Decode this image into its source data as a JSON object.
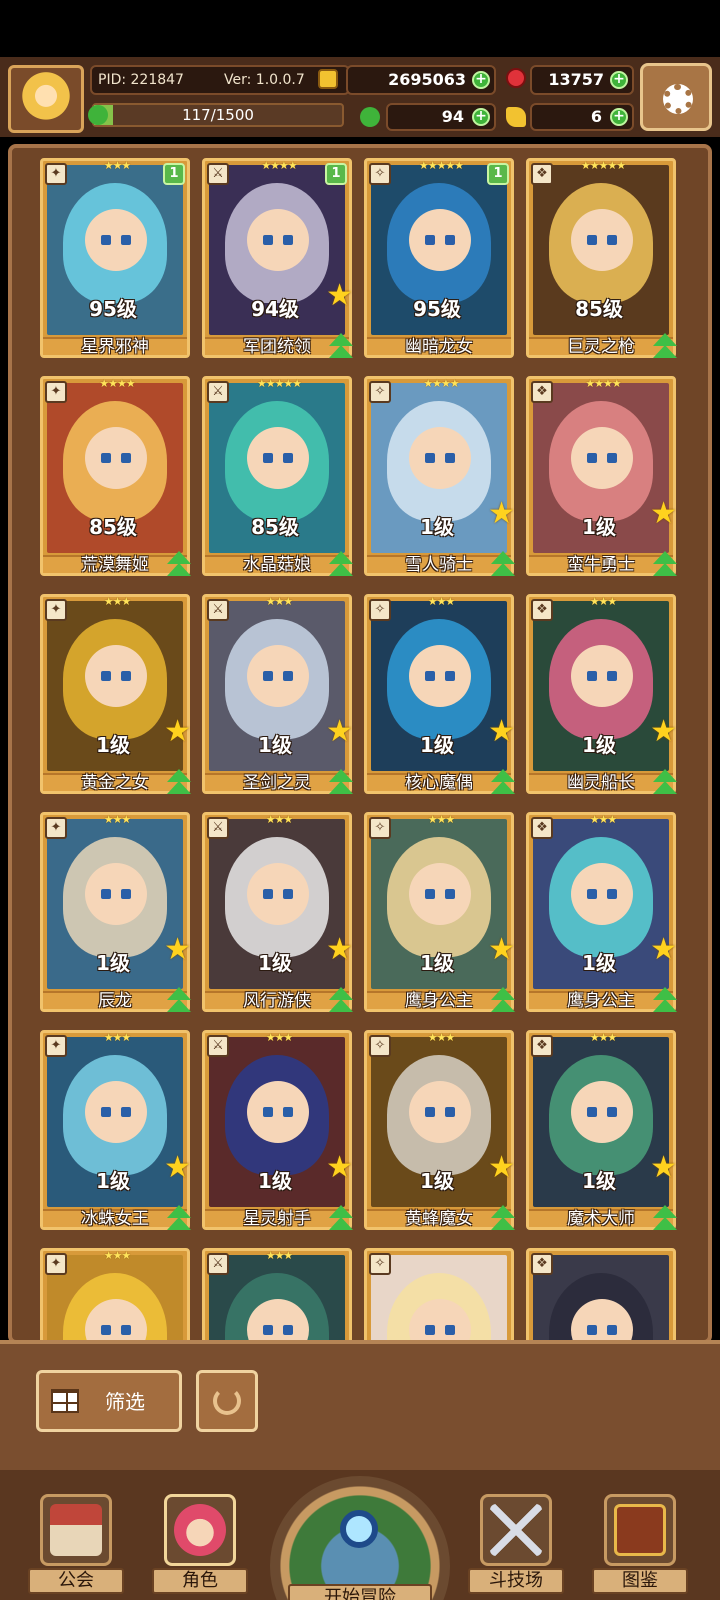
{
  "header": {
    "pid_label": "PID: 221847",
    "version_label": "Ver: 1.0.0.7",
    "gold": "2695063",
    "gems": "13757",
    "exp_text": "117/1500",
    "exp_fraction": 0.078,
    "clover": "94",
    "keys": "6",
    "icons": {
      "gold": "gold-coin-icon",
      "gems": "red-gem-icon",
      "clover": "clover-icon",
      "keys": "key-icon",
      "exp": "clover-exp-icon",
      "settings": "gear-icon"
    }
  },
  "heroes": [
    {
      "name": "星界邪神",
      "level": "95级",
      "stars": "★★★",
      "badge": "1",
      "hair": "#6fd2e8",
      "bg": "#3a6e8a",
      "star_icon": false,
      "upgrade": false
    },
    {
      "name": "军团统领",
      "level": "94级",
      "stars": "★★★★",
      "badge": "1",
      "hair": "#c7c0d8",
      "bg": "#3a2f55",
      "star_icon": true,
      "upgrade": true
    },
    {
      "name": "幽暗龙女",
      "level": "95级",
      "stars": "★★★★★",
      "badge": "1",
      "hair": "#2f84c7",
      "bg": "#1e4b6a",
      "star_icon": false,
      "upgrade": false
    },
    {
      "name": "巨灵之枪",
      "level": "85级",
      "stars": "★★★★★",
      "badge": "",
      "hair": "#f1c45a",
      "bg": "#5a3a1e",
      "star_icon": false,
      "upgrade": true
    },
    {
      "name": "荒漠舞姬",
      "level": "85级",
      "stars": "★★★★",
      "badge": "",
      "hair": "#f4c05a",
      "bg": "#b04a2a",
      "star_icon": false,
      "upgrade": true
    },
    {
      "name": "水晶菇娘",
      "level": "85级",
      "stars": "★★★★★",
      "badge": "",
      "hair": "#46c9b2",
      "bg": "#2a7a8a",
      "star_icon": false,
      "upgrade": true
    },
    {
      "name": "雪人骑士",
      "level": "1级",
      "stars": "★★★★",
      "badge": "",
      "hair": "#d6e6f2",
      "bg": "#6a9ac0",
      "star_icon": true,
      "upgrade": true
    },
    {
      "name": "蛮牛勇士",
      "level": "1级",
      "stars": "★★★★",
      "badge": "",
      "hair": "#e58a8a",
      "bg": "#8a4a4a",
      "star_icon": true,
      "upgrade": true
    },
    {
      "name": "黄金之女",
      "level": "1级",
      "stars": "★★★",
      "badge": "",
      "hair": "#e6b430",
      "bg": "#6a4a1a",
      "star_icon": true,
      "upgrade": true
    },
    {
      "name": "圣剑之灵",
      "level": "1级",
      "stars": "★★★",
      "badge": "",
      "hair": "#c9d6e6",
      "bg": "#5a5a6a",
      "star_icon": true,
      "upgrade": true
    },
    {
      "name": "核心魔偶",
      "level": "1级",
      "stars": "★★★",
      "badge": "",
      "hair": "#2e9ad6",
      "bg": "#1e3e5a",
      "star_icon": true,
      "upgrade": true
    },
    {
      "name": "幽灵船长",
      "level": "1级",
      "stars": "★★★",
      "badge": "",
      "hair": "#e0648a",
      "bg": "#2a4a3a",
      "star_icon": true,
      "upgrade": true
    },
    {
      "name": "辰龙",
      "level": "1级",
      "stars": "★★★",
      "badge": "",
      "hair": "#e8d6b8",
      "bg": "#3a6a8a",
      "star_icon": true,
      "upgrade": true
    },
    {
      "name": "风行游侠",
      "level": "1级",
      "stars": "★★★",
      "badge": "",
      "hair": "#eaeaea",
      "bg": "#4a3a3a",
      "star_icon": true,
      "upgrade": true
    },
    {
      "name": "鹰身公主",
      "level": "1级",
      "stars": "★★★",
      "badge": "",
      "hair": "#f2d69a",
      "bg": "#4a6a5a",
      "star_icon": true,
      "upgrade": true
    },
    {
      "name": "鹰身公主",
      "level": "1级",
      "stars": "★★★",
      "badge": "",
      "hair": "#5ad2d6",
      "bg": "#3a4a7a",
      "star_icon": true,
      "upgrade": true
    },
    {
      "name": "冰蛛女王",
      "level": "1级",
      "stars": "★★★",
      "badge": "",
      "hair": "#7ad0e6",
      "bg": "#2a5a7a",
      "star_icon": true,
      "upgrade": true
    },
    {
      "name": "星灵射手",
      "level": "1级",
      "stars": "★★★",
      "badge": "",
      "hair": "#2a3a8a",
      "bg": "#5a2a2a",
      "star_icon": true,
      "upgrade": true
    },
    {
      "name": "黄蜂魔女",
      "level": "1级",
      "stars": "★★★",
      "badge": "",
      "hair": "#d6d0c6",
      "bg": "#6a4a1a",
      "star_icon": true,
      "upgrade": true
    },
    {
      "name": "魔术大师",
      "level": "1级",
      "stars": "★★★",
      "badge": "",
      "hair": "#4aa07a",
      "bg": "#2a3a4a",
      "star_icon": true,
      "upgrade": true
    },
    {
      "name": "",
      "level": "",
      "stars": "★★★",
      "badge": "",
      "hair": "#f2c43a",
      "bg": "#c08a2a",
      "star_icon": false,
      "upgrade": false
    },
    {
      "name": "",
      "level": "",
      "stars": "★★★",
      "badge": "",
      "hair": "#3a7a6a",
      "bg": "#2a4a4a",
      "star_icon": false,
      "upgrade": false
    },
    {
      "name": "",
      "level": "",
      "stars": "",
      "badge": "",
      "hair": "#f6e0a0",
      "bg": "#e8d6c8",
      "star_icon": false,
      "upgrade": false
    },
    {
      "name": "",
      "level": "",
      "stars": "",
      "badge": "",
      "hair": "#2a2a3a",
      "bg": "#3a3a4a",
      "star_icon": false,
      "upgrade": false
    }
  ],
  "filter": {
    "filter_label": "筛选",
    "filter_icon": "grid-icon",
    "reset_icon": "refresh-icon"
  },
  "nav": {
    "guild": "公会",
    "characters": "角色",
    "start": "开始冒险",
    "arena": "斗技场",
    "codex": "图鉴"
  }
}
